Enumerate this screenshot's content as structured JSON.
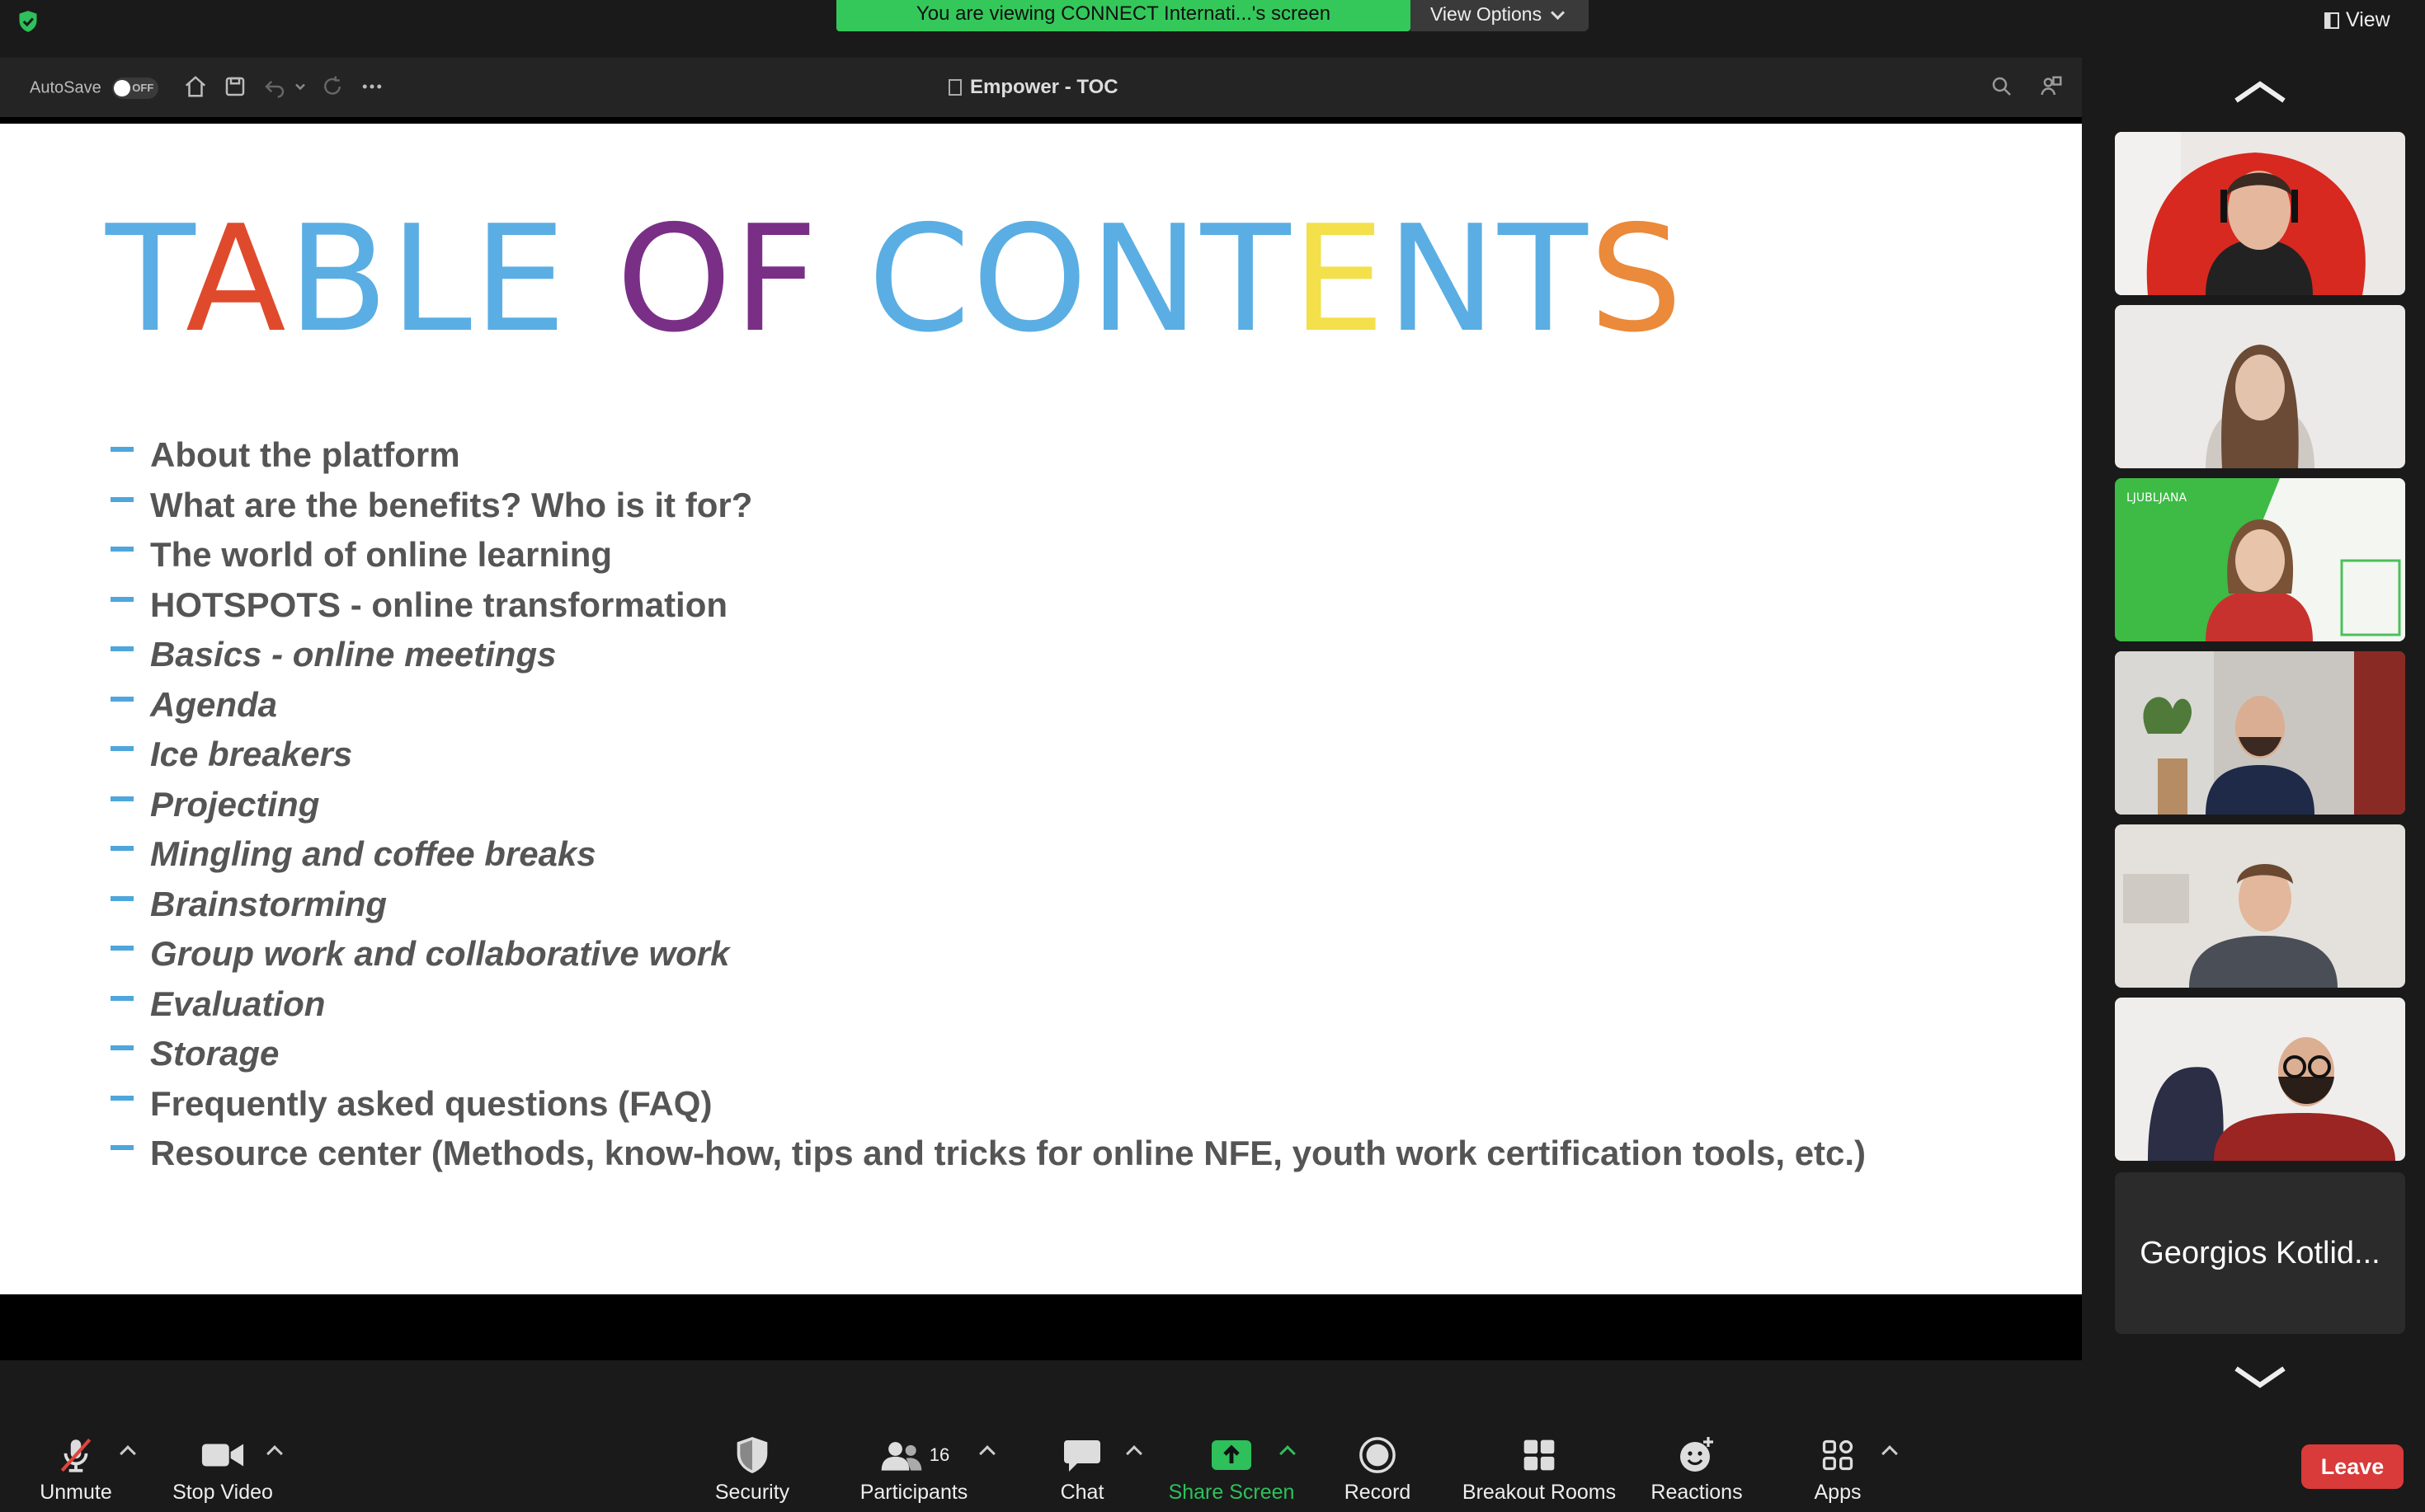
{
  "top": {
    "banner_text": "You are viewing CONNECT Internati...'s screen",
    "view_options_label": "View Options",
    "view_label": "View"
  },
  "powerpoint": {
    "autosave_label": "AutoSave",
    "autosave_state": "OFF",
    "document_title": "Empower - TOC"
  },
  "slide": {
    "title_letters": [
      {
        "ch": "T",
        "color": "#5aaee3"
      },
      {
        "ch": "A",
        "color": "#e04a2c"
      },
      {
        "ch": "B",
        "color": "#5aaee3"
      },
      {
        "ch": "L",
        "color": "#5aaee3"
      },
      {
        "ch": "E",
        "color": "#5aaee3"
      },
      {
        "ch": " ",
        "color": "#5aaee3"
      },
      {
        "ch": "O",
        "color": "#7a2f87"
      },
      {
        "ch": "F",
        "color": "#7a2f87"
      },
      {
        "ch": " ",
        "color": "#5aaee3"
      },
      {
        "ch": "C",
        "color": "#5aaee3"
      },
      {
        "ch": "O",
        "color": "#5aaee3"
      },
      {
        "ch": "N",
        "color": "#5aaee3"
      },
      {
        "ch": "T",
        "color": "#5aaee3"
      },
      {
        "ch": "E",
        "color": "#f3e04a"
      },
      {
        "ch": "N",
        "color": "#5aaee3"
      },
      {
        "ch": "T",
        "color": "#5aaee3"
      },
      {
        "ch": "S",
        "color": "#ea8a3a"
      }
    ],
    "items": [
      {
        "text": "About the platform",
        "italic": false
      },
      {
        "text": "What are the benefits? Who is it for?",
        "italic": false
      },
      {
        "text": "The world of online learning",
        "italic": false
      },
      {
        "text": "HOTSPOTS - online transformation",
        "italic": false
      },
      {
        "text": "Basics - online meetings",
        "italic": true
      },
      {
        "text": "Agenda",
        "italic": true
      },
      {
        "text": "Ice breakers",
        "italic": true
      },
      {
        "text": "Projecting",
        "italic": true
      },
      {
        "text": "Mingling and coffee breaks",
        "italic": true
      },
      {
        "text": "Brainstorming",
        "italic": true
      },
      {
        "text": "Group work and collaborative work",
        "italic": true
      },
      {
        "text": "Evaluation",
        "italic": true
      },
      {
        "text": "Storage",
        "italic": true
      },
      {
        "text": "Frequently asked questions (FAQ)",
        "italic": false
      },
      {
        "text": "Resource center (Methods, know-how, tips and tricks for online NFE, youth work certification tools, etc.)",
        "italic": false
      }
    ]
  },
  "gallery": {
    "name_tile": "Georgios Kotlid..."
  },
  "toolbar": {
    "unmute": "Unmute",
    "stop_video": "Stop Video",
    "security": "Security",
    "participants": "Participants",
    "participants_count": "16",
    "chat": "Chat",
    "share_screen": "Share Screen",
    "record": "Record",
    "breakout_rooms": "Breakout Rooms",
    "reactions": "Reactions",
    "apps": "Apps",
    "leave": "Leave"
  }
}
